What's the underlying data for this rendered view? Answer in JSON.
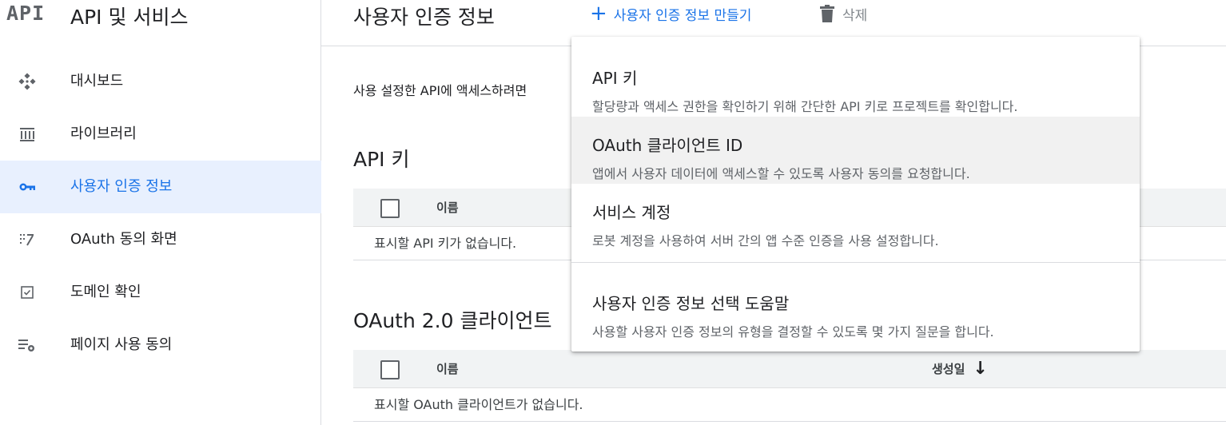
{
  "sidebar": {
    "logo": "API",
    "title": "API 및 서비스",
    "items": [
      {
        "label": "대시보드",
        "icon": "dashboard-icon"
      },
      {
        "label": "라이브러리",
        "icon": "library-icon"
      },
      {
        "label": "사용자 인증 정보",
        "icon": "key-icon",
        "active": true
      },
      {
        "label": "OAuth 동의 화면",
        "icon": "consent-icon"
      },
      {
        "label": "도메인 확인",
        "icon": "checkbox-icon"
      },
      {
        "label": "페이지 사용 동의",
        "icon": "settings-list-icon"
      }
    ]
  },
  "header": {
    "title": "사용자 인증 정보",
    "create_label": "사용자 인증 정보 만들기",
    "delete_label": "삭제"
  },
  "main": {
    "intro": "사용 설정한 API에 액세스하려면",
    "api_keys": {
      "title": "API 키",
      "col_name": "이름",
      "empty": "표시할 API 키가 없습니다."
    },
    "oauth": {
      "title": "OAuth 2.0 클라이언트",
      "col_name": "이름",
      "col_date": "생성일",
      "sort_arrow": "↓",
      "empty": "표시할 OAuth 클라이언트가 없습니다."
    }
  },
  "dropdown": {
    "items": [
      {
        "title": "API 키",
        "desc": "할당량과 액세스 권한을 확인하기 위해 간단한 API 키로 프로젝트를 확인합니다."
      },
      {
        "title": "OAuth 클라이언트 ID",
        "desc": "앱에서 사용자 데이터에 액세스할 수 있도록 사용자 동의를 요청합니다.",
        "hover": true
      },
      {
        "title": "서비스 계정",
        "desc": "로봇 계정을 사용하여 서버 간의 앱 수준 인증을 사용 설정합니다."
      },
      {
        "title": "사용자 인증 정보 선택 도움말",
        "desc": "사용할 사용자 인증 정보의 유형을 결정할 수 있도록 몇 가지 질문을 합니다."
      }
    ]
  },
  "colors": {
    "accent": "#1a73e8",
    "active_bg": "#e8f0fe",
    "table_header_bg": "#f1f3f4",
    "hover_bg": "#f1f1f1"
  }
}
